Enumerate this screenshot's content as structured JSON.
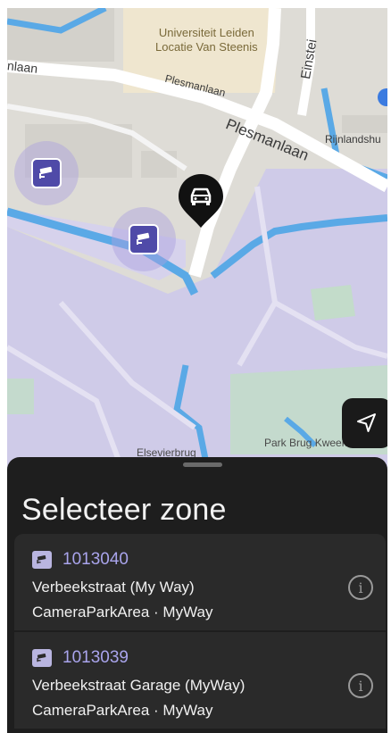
{
  "map": {
    "labels": {
      "university": "Universiteit Leiden\nLocatie Van Steenis",
      "einstein": "Einstei",
      "left_laan": "nlaan",
      "plesmanlaan_small": "Plesmanlaan",
      "plesmanlaan_big": "Plesmanlaan",
      "rijnlandshu": "Rijnlandshu",
      "park": "Park Brug Kweektuin",
      "elsevier": "Elsevierbrug"
    },
    "icons": {
      "camera_pin": "camera-icon",
      "car_pin": "car-icon",
      "locate": "location-arrow-icon"
    }
  },
  "sheet": {
    "title": "Selecteer zone",
    "zones": [
      {
        "id": "1013040",
        "name": "Verbeekstraat (My Way)",
        "type": "CameraParkArea · MyWay"
      },
      {
        "id": "1013039",
        "name": "Verbeekstraat Garage (MyWay)",
        "type": "CameraParkArea · MyWay"
      }
    ]
  },
  "colors": {
    "water": "#5aa9e6",
    "zone_fill": "#cfcbe8",
    "camera_badge": "#4f4aa8",
    "zone_id_text": "#a9a4ec",
    "sheet_bg": "#1e1e1e",
    "card_bg": "#2a2a2a"
  }
}
